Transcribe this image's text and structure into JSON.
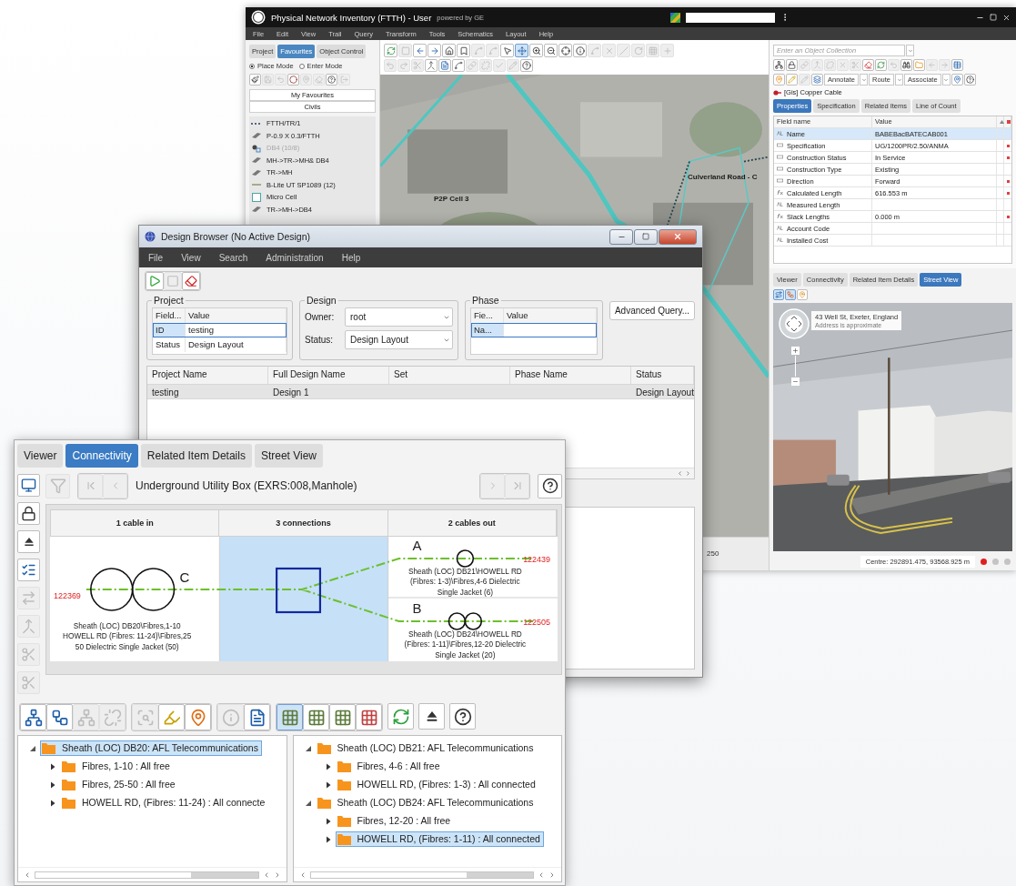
{
  "app_window": {
    "title": "Physical Network Inventory (FTTH) - User",
    "subtitle": "powered by GE",
    "menu": [
      "File",
      "Edit",
      "View",
      "Trail",
      "Query",
      "Transform",
      "Tools",
      "Schematics",
      "Layout",
      "Help"
    ],
    "left_panel": {
      "tabs": [
        {
          "label": "Project",
          "selected": false
        },
        {
          "label": "Favourites",
          "selected": true
        },
        {
          "label": "Object Control",
          "selected": false
        }
      ],
      "modes": [
        {
          "label": "Place Mode",
          "selected": true
        },
        {
          "label": "Enter Mode",
          "selected": false
        }
      ],
      "tools": [
        {
          "disabled": false
        },
        {
          "disabled": true
        },
        {
          "disabled": true
        },
        {
          "disabled": false
        },
        {
          "disabled": true
        },
        {
          "disabled": true
        },
        {
          "disabled": false
        },
        {
          "disabled": true
        }
      ],
      "sections": [
        "My Favourites",
        "Civils"
      ],
      "items": [
        {
          "label": "FTTH/TR/1",
          "kind": "dashed",
          "disabled": false
        },
        {
          "label": "P-0.9 X 0.3/FTTH",
          "kind": "duct",
          "disabled": false
        },
        {
          "label": "DB4 (10/8)",
          "kind": "node",
          "disabled": true
        },
        {
          "label": "MH->TR->MH& DB4",
          "kind": "duct",
          "disabled": false
        },
        {
          "label": "TR->MH",
          "kind": "duct",
          "disabled": false
        },
        {
          "label": "B-Lite UT SP1089 (12)",
          "kind": "line",
          "disabled": false
        },
        {
          "label": "Micro Cell",
          "kind": "cell",
          "disabled": false
        },
        {
          "label": "TR->MH->DB4",
          "kind": "duct",
          "disabled": false
        }
      ]
    },
    "map": {
      "tools_row_1": [
        {
          "disabled": false,
          "selected": false
        },
        {
          "disabled": true,
          "selected": false
        },
        {
          "disabled": false,
          "selected": false
        },
        {
          "disabled": false,
          "selected": false
        },
        {
          "disabled": false,
          "selected": false
        },
        {
          "disabled": false,
          "selected": false
        },
        {
          "disabled": true,
          "selected": false
        },
        {
          "disabled": true,
          "selected": false
        },
        {
          "disabled": false,
          "selected": false
        },
        {
          "disabled": false,
          "selected": true
        },
        {
          "disabled": false,
          "selected": false
        },
        {
          "disabled": false,
          "selected": false
        },
        {
          "disabled": false,
          "selected": false
        },
        {
          "disabled": false,
          "selected": false
        },
        {
          "disabled": true,
          "selected": false
        },
        {
          "disabled": true,
          "selected": false
        },
        {
          "disabled": true,
          "selected": false
        },
        {
          "disabled": true,
          "selected": false
        },
        {
          "disabled": true,
          "selected": false
        },
        {
          "disabled": true,
          "selected": false
        }
      ],
      "tools_row_2": [
        {
          "disabled": true
        },
        {
          "disabled": true
        },
        {
          "disabled": true
        },
        {
          "disabled": false
        },
        {
          "disabled": false
        },
        {
          "disabled": false
        },
        {
          "disabled": true
        },
        {
          "disabled": true
        },
        {
          "disabled": true
        },
        {
          "disabled": true
        },
        {
          "disabled": false
        }
      ],
      "labels": [
        "P2P Cell 3",
        "Culverland Road - C"
      ],
      "scale": "250"
    },
    "object_panel": {
      "collection": {
        "placeholder": "Enter an Object Collection"
      },
      "tools": [
        {
          "disabled": false
        },
        {
          "disabled": false
        },
        {
          "disabled": true
        },
        {
          "disabled": true
        },
        {
          "disabled": true
        },
        {
          "disabled": true
        },
        {
          "disabled": true
        },
        {
          "disabled": false
        },
        {
          "disabled": false
        },
        {
          "disabled": true
        },
        {
          "disabled": false
        },
        {
          "disabled": false
        },
        {
          "disabled": true
        },
        {
          "disabled": true
        },
        {
          "disabled": false
        }
      ],
      "edit_tools": [
        {
          "disabled": false
        },
        {
          "disabled": false
        },
        {
          "disabled": true
        },
        {
          "disabled": false
        }
      ],
      "actions": [
        "Annotate",
        "Route",
        "Associate"
      ],
      "object": "[Gis] Copper Cable",
      "tabs": [
        {
          "label": "Properties",
          "selected": true
        },
        {
          "label": "Specification",
          "selected": false
        },
        {
          "label": "Related Items",
          "selected": false
        },
        {
          "label": "Line of Count",
          "selected": false
        }
      ],
      "columns": [
        "Field name",
        "Value"
      ],
      "rows": [
        {
          "kind": "text",
          "field": "Name",
          "value": "BABEBacBATECAB001",
          "required": false,
          "selected": true
        },
        {
          "kind": "list",
          "field": "Specification",
          "value": "UG/1200PR/2.50/ANMA",
          "required": true,
          "selected": false
        },
        {
          "kind": "list",
          "field": "Construction Status",
          "value": "In Service",
          "required": true,
          "selected": false
        },
        {
          "kind": "list",
          "field": "Construction Type",
          "value": "Existing",
          "required": false,
          "selected": false
        },
        {
          "kind": "list",
          "field": "Direction",
          "value": "Forward",
          "required": true,
          "selected": false
        },
        {
          "kind": "formula",
          "field": "Calculated Length",
          "value": "616.553 m",
          "required": true,
          "selected": false
        },
        {
          "kind": "text",
          "field": "Measured Length",
          "required": false,
          "selected": false
        },
        {
          "kind": "formula",
          "field": "Slack Lengths",
          "value": "0.000 m",
          "required": true,
          "selected": false
        },
        {
          "kind": "text",
          "field": "Account Code",
          "required": false,
          "selected": false
        },
        {
          "kind": "text",
          "field": "Installed Cost",
          "required": false,
          "selected": false
        }
      ]
    },
    "street_panel": {
      "tabs": [
        {
          "label": "Viewer",
          "selected": false
        },
        {
          "label": "Connectivity",
          "selected": false
        },
        {
          "label": "Related Item Details",
          "selected": false
        },
        {
          "label": "Street View",
          "selected": true
        }
      ],
      "tools": [
        {
          "selected": true
        },
        {
          "selected": true
        },
        {
          "selected": false
        }
      ],
      "address": "43 Well St, Exeter, England",
      "address_note": "Address is approximate"
    },
    "status_bar": {
      "centre": "Centre: 292891.475, 93568.925 m",
      "indicators": [
        {
          "color": "#e01e1e"
        },
        {
          "color": "#c4c4c4"
        },
        {
          "color": "#c4c4c4"
        }
      ]
    }
  },
  "design_browser": {
    "title": "Design Browser (No Active Design)",
    "menu": [
      "File",
      "View",
      "Search",
      "Administration",
      "Help"
    ],
    "tools": [
      {
        "disabled": false
      },
      {
        "disabled": true
      },
      {
        "disabled": false
      }
    ],
    "project": {
      "label": "Project",
      "columns": [
        "Field...",
        "Value"
      ],
      "rows": [
        {
          "field": "ID",
          "value": "testing",
          "selected": true
        },
        {
          "field": "Status",
          "value": "Design Layout",
          "selected": false
        }
      ]
    },
    "design": {
      "label": "Design",
      "fields": [
        {
          "label": "Owner:",
          "value": "root"
        },
        {
          "label": "Status:",
          "value": "Design Layout"
        }
      ]
    },
    "phase": {
      "label": "Phase",
      "columns": [
        "Fie...",
        "Value"
      ],
      "rows": [
        {
          "field": "Na...",
          "selected": true
        }
      ]
    },
    "advanced_button": "Advanced Query...",
    "results": {
      "columns": [
        "Project Name",
        "Full Design Name",
        "Set",
        "Phase Name",
        "Status"
      ],
      "rows": [
        {
          "cells": [
            "testing",
            "Design 1",
            null,
            null,
            "Design Layout"
          ],
          "selected": true
        }
      ]
    }
  },
  "connectivity": {
    "tabs": [
      {
        "label": "Viewer",
        "selected": false
      },
      {
        "label": "Connectivity",
        "selected": true
      },
      {
        "label": "Related Item Details",
        "selected": false
      },
      {
        "label": "Street View",
        "selected": false
      }
    ],
    "side_tools": [
      {
        "disabled": false
      },
      {
        "disabled": false
      },
      {
        "disabled": false
      },
      {
        "disabled": false
      },
      {
        "disabled": true
      },
      {
        "disabled": true
      },
      {
        "disabled": true
      },
      {
        "disabled": true
      }
    ],
    "nav": {
      "title": "Underground Utility Box (EXRS:008,Manhole)",
      "first_disabled": true,
      "last_disabled": true
    },
    "diagram": {
      "headers": [
        "1 cable in",
        "3 connections",
        "2 cables out"
      ],
      "cable_in": {
        "letter": "C",
        "number": "122369",
        "kind": "double",
        "caption": "Sheath (LOC) DB20\\Fibres,1-10\nHOWELL RD (Fibres: 11-24)\\Fibres,25\n50 Dielectric Single Jacket (50)"
      },
      "cables_out": [
        {
          "letter": "A",
          "number": "122439",
          "kind": "single",
          "caption": "Sheath (LOC) DB21\\HOWELL RD\n(Fibres: 1-3)\\Fibres,4-6 Dielectric\nSingle Jacket (6)"
        },
        {
          "letter": "B",
          "number": "122505",
          "kind": "double",
          "caption": "Sheath (LOC) DB24\\HOWELL RD\n(Fibres: 1-11)\\Fibres,12-20 Dielectric\nSingle Jacket (20)"
        }
      ]
    },
    "tools": [
      {
        "disabled": false,
        "selected": false
      },
      {
        "disabled": false,
        "selected": false
      },
      {
        "disabled": true,
        "selected": false
      },
      {
        "disabled": true,
        "selected": false
      },
      {
        "disabled": true,
        "selected": false
      },
      {
        "disabled": false,
        "selected": false
      },
      {
        "disabled": false,
        "selected": false
      },
      {
        "disabled": true,
        "selected": false
      },
      {
        "disabled": false,
        "selected": false
      },
      {
        "disabled": false,
        "selected": true
      },
      {
        "disabled": false,
        "selected": false
      },
      {
        "disabled": false,
        "selected": false
      },
      {
        "disabled": false,
        "selected": false
      },
      {
        "disabled": false,
        "selected": false
      },
      {
        "disabled": false,
        "selected": false
      },
      {
        "disabled": false,
        "selected": false
      }
    ],
    "trees": [
      [
        {
          "label": "Sheath (LOC) DB20: AFL Telecommunications",
          "expanded": true,
          "selected": true,
          "children": [
            {
              "label": "Fibres, 1-10  : All free",
              "expanded": false,
              "selected": false
            },
            {
              "label": "Fibres, 25-50  : All free",
              "expanded": false,
              "selected": false
            },
            {
              "label": "HOWELL RD,  (Fibres: 11-24) : All connecte",
              "expanded": false,
              "selected": false
            }
          ]
        }
      ],
      [
        {
          "label": "Sheath (LOC) DB21: AFL Telecommunications",
          "expanded": true,
          "selected": false,
          "children": [
            {
              "label": "Fibres, 4-6  : All free",
              "expanded": false,
              "selected": false
            },
            {
              "label": "HOWELL RD,  (Fibres: 1-3) : All connected",
              "expanded": false,
              "selected": false
            }
          ]
        },
        {
          "label": "Sheath (LOC) DB24: AFL Telecommunications",
          "expanded": true,
          "selected": false,
          "children": [
            {
              "label": "Fibres, 12-20  : All free",
              "expanded": false,
              "selected": false
            },
            {
              "label": "HOWELL RD,  (Fibres: 1-11) : All connected",
              "expanded": false,
              "selected": true
            }
          ]
        }
      ]
    ]
  }
}
